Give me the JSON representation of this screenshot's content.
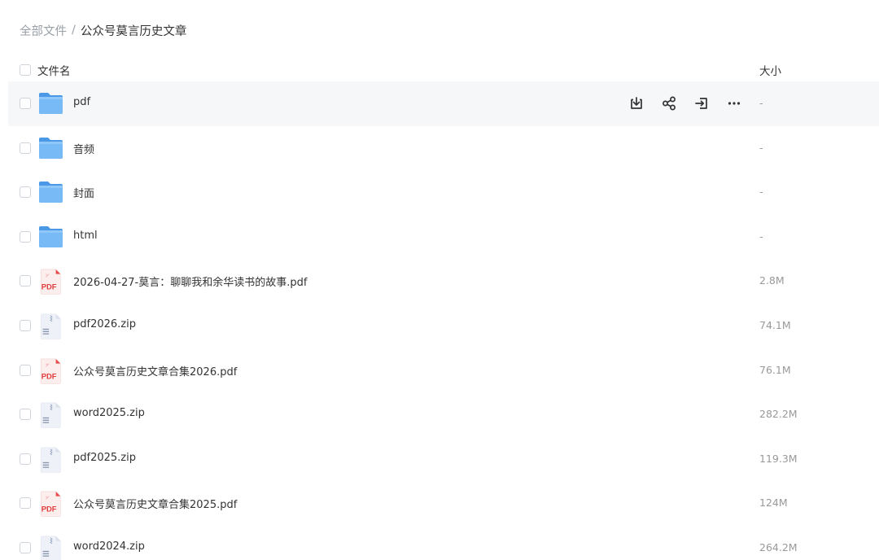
{
  "breadcrumb": {
    "root": "全部文件",
    "separator": "/",
    "current": "公众号莫言历史文章"
  },
  "header": {
    "name_label": "文件名",
    "size_label": "大小"
  },
  "actions": {
    "download_icon": "download-icon",
    "share_icon": "share-icon",
    "move_icon": "move-icon",
    "more_icon": "more-icon",
    "more_glyph": "···"
  },
  "files": [
    {
      "name": "pdf",
      "size": "-",
      "type": "folder"
    },
    {
      "name": "音频",
      "size": "-",
      "type": "folder"
    },
    {
      "name": "封面",
      "size": "-",
      "type": "folder"
    },
    {
      "name": "html",
      "size": "-",
      "type": "folder"
    },
    {
      "name": "2026-04-27-莫言：聊聊我和余华读书的故事.pdf",
      "size": "2.8M",
      "type": "pdf"
    },
    {
      "name": "pdf2026.zip",
      "size": "74.1M",
      "type": "zip"
    },
    {
      "name": "公众号莫言历史文章合集2026.pdf",
      "size": "76.1M",
      "type": "pdf"
    },
    {
      "name": "word2025.zip",
      "size": "282.2M",
      "type": "zip"
    },
    {
      "name": "pdf2025.zip",
      "size": "119.3M",
      "type": "zip"
    },
    {
      "name": "公众号莫言历史文章合集2025.pdf",
      "size": "124M",
      "type": "pdf"
    },
    {
      "name": "word2024.zip",
      "size": "264.2M",
      "type": "zip"
    }
  ],
  "pdf_badge": "PDF",
  "colors": {
    "folder": "#5aa9f0",
    "pdf_red": "#e84b4b",
    "zip_gray": "#e6eaf3",
    "hover_bg": "#f6f7f9"
  }
}
